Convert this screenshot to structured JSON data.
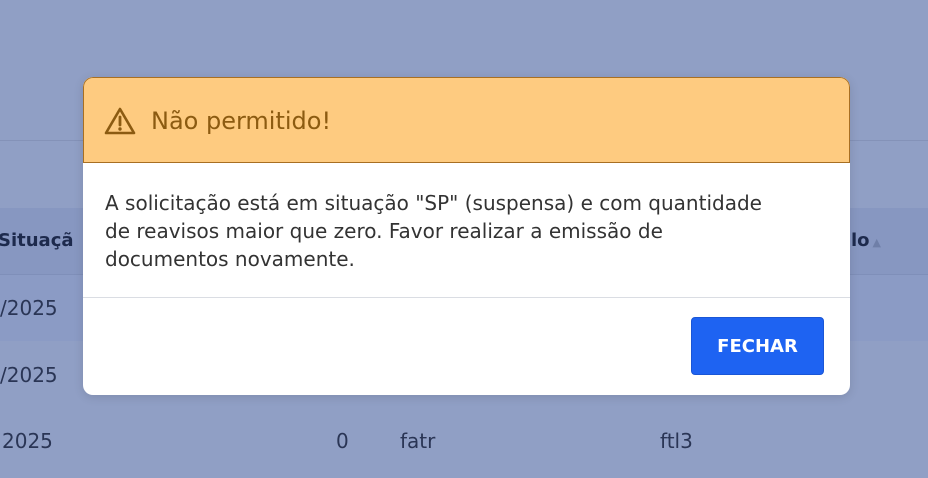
{
  "table": {
    "headers": {
      "situacao": "Situaçã",
      "titulo": "lo"
    },
    "rows": [
      {
        "date": "/2025"
      },
      {
        "date": "/2025"
      },
      {
        "date": "2025",
        "count": "0",
        "user": "fatr",
        "code": "ftl3"
      }
    ]
  },
  "modal": {
    "title": "Não permitido!",
    "message": "A solicitação está em situação \"SP\" (suspensa) e com quantidade de reavisos maior que zero. Favor realizar a emissão de documentos novamente.",
    "close_label": "FECHAR",
    "header_icon": "warning-icon"
  },
  "colors": {
    "overlay": "#909fc5",
    "header_bg": "#fecb80",
    "header_text": "#8c5b11",
    "button_bg": "#1e63f2"
  }
}
